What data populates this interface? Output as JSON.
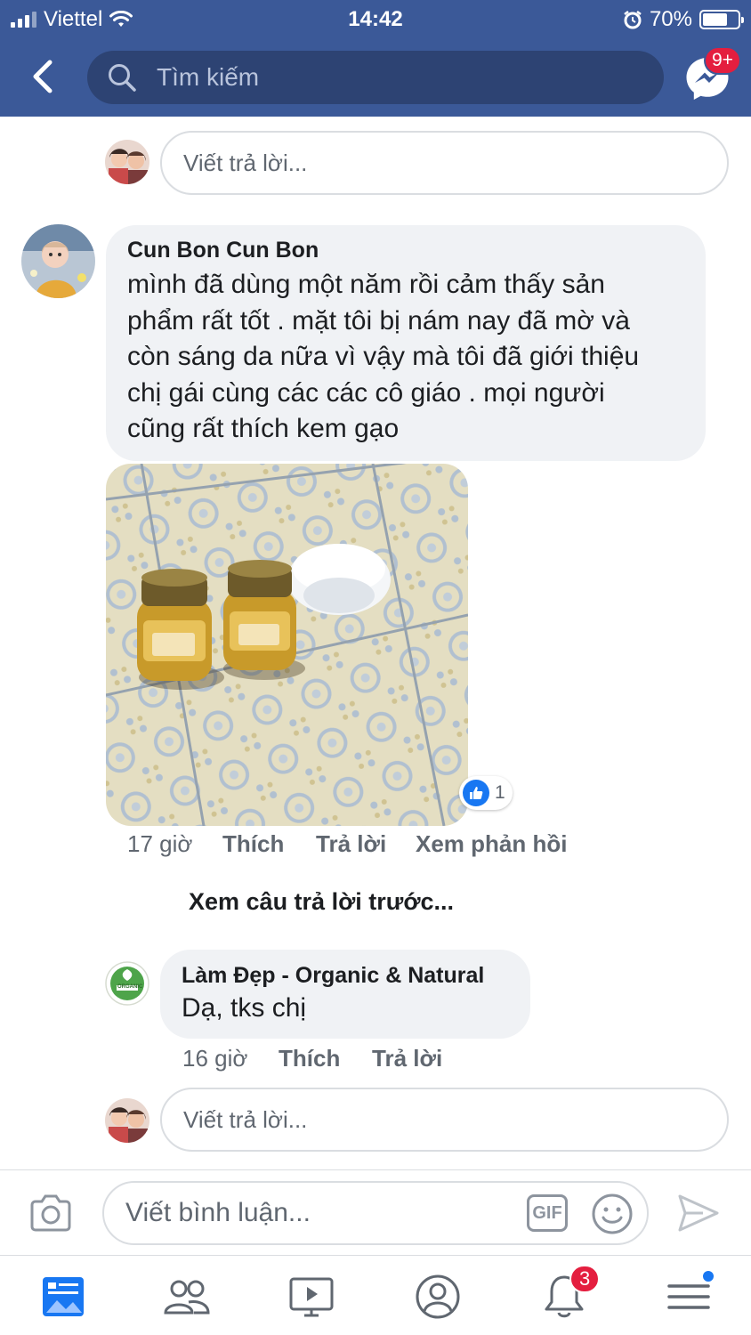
{
  "status_bar": {
    "carrier": "Viettel",
    "time": "14:42",
    "battery": "70%",
    "battery_level": 0.7
  },
  "header": {
    "search_placeholder": "Tìm kiếm",
    "messenger_badge": "9+"
  },
  "top_reply": {
    "placeholder": "Viết trả lời..."
  },
  "comment": {
    "author": "Cun Bon Cun Bon",
    "lines": [
      "mình đã dùng một năm rồi cảm thấy sản",
      "phẩm rất tốt . mặt tôi bị nám nay đã mờ và",
      "còn sáng da nữa vì vậy mà tôi đã giới thiệu",
      "chị gái cùng các các cô giáo . mọi người",
      "cũng rất thích kem gạo"
    ],
    "reaction_count": "1",
    "time": "17 giờ",
    "like_label": "Thích",
    "reply_label": "Trả lời",
    "view_replies_label": "Xem phản hồi"
  },
  "previous_replies_label": "Xem câu trả lời trước...",
  "page_reply": {
    "author": "Làm Đẹp - Organic & Natural",
    "text": "Dạ, tks chị",
    "time": "16 giờ",
    "like_label": "Thích",
    "reply_label": "Trả lời",
    "logo_text": "ORGANIC"
  },
  "bottom_reply": {
    "placeholder": "Viết trả lời..."
  },
  "composer": {
    "placeholder": "Viết bình luận...",
    "gif_label": "GIF"
  },
  "tabbar": {
    "notification_badge": "3"
  },
  "colors": {
    "brand": "#3b5998",
    "accent": "#1877f2",
    "badge": "#e41e3f"
  }
}
